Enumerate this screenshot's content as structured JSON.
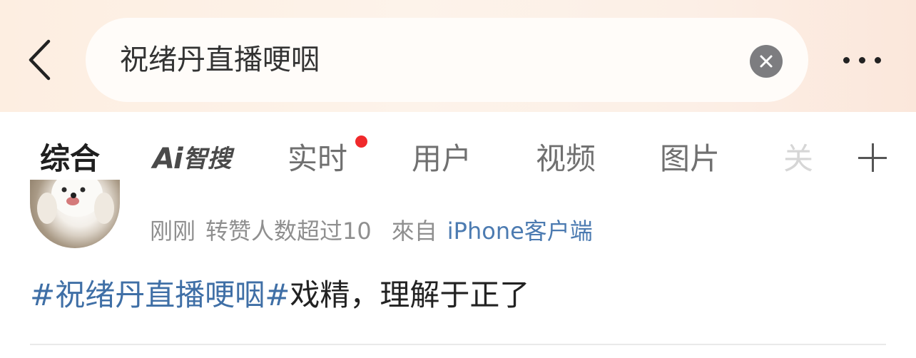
{
  "header": {
    "back_icon": "chevron-left-icon",
    "search_value": "祝绪丹直播哽咽",
    "clear_icon": "close-icon",
    "more_icon": "more-dots-icon"
  },
  "tabs": [
    {
      "label": "综合",
      "active": true
    },
    {
      "label_ai": "Ai",
      "label": "智搜"
    },
    {
      "label": "实时",
      "badge": "red-dot"
    },
    {
      "label": "用户"
    },
    {
      "label": "视频"
    },
    {
      "label": "图片"
    },
    {
      "label": "关"
    }
  ],
  "add_tab_icon": "plus-icon",
  "post": {
    "time": "刚刚",
    "reposts": "转赞人数超过10",
    "source_prefix": "來自",
    "source_app": "iPhone客户端",
    "topic": "#祝绪丹直播哽咽#",
    "text": "戏精，理解于正了"
  },
  "colors": {
    "accent_orange": "#ff7a00",
    "link_blue": "#3f6fa6",
    "badge_red": "#f0292b"
  }
}
